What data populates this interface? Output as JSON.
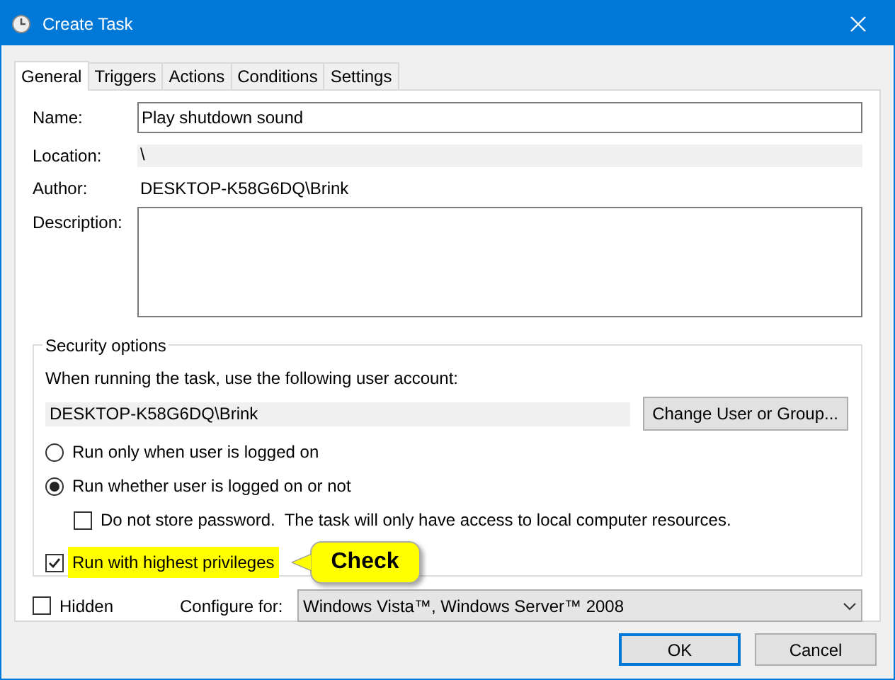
{
  "window": {
    "title": "Create Task"
  },
  "tabs": [
    {
      "label": "General",
      "selected": true
    },
    {
      "label": "Triggers",
      "selected": false
    },
    {
      "label": "Actions",
      "selected": false
    },
    {
      "label": "Conditions",
      "selected": false
    },
    {
      "label": "Settings",
      "selected": false
    }
  ],
  "general": {
    "name": {
      "label": "Name:",
      "value": "Play shutdown sound"
    },
    "location": {
      "label": "Location:",
      "value": "\\"
    },
    "author": {
      "label": "Author:",
      "value": "DESKTOP-K58G6DQ\\Brink"
    },
    "description": {
      "label": "Description:"
    },
    "security": {
      "title": "Security options",
      "prompt": "When running the task, use the following user account:",
      "account": "DESKTOP-K58G6DQ\\Brink",
      "change_button": "Change User or Group...",
      "options": [
        {
          "kind": "radio",
          "label": "Run only when user is logged on",
          "selected": false
        },
        {
          "kind": "radio",
          "label": "Run whether user is logged on or not",
          "selected": true,
          "children": [
            {
              "kind": "checkbox",
              "label": "Do not store password.  The task will only have access to local computer resources.",
              "checked": false
            }
          ]
        }
      ],
      "highest": {
        "label": "Run with highest privileges",
        "checked": true,
        "highlighted": true,
        "callout": "Check"
      }
    },
    "hidden": {
      "label": "Hidden",
      "checked": false
    },
    "configure": {
      "label": "Configure for:",
      "value": "Windows Vista™, Windows Server™ 2008"
    }
  },
  "buttons": [
    {
      "label": "OK",
      "default": true
    },
    {
      "label": "Cancel",
      "default": false
    }
  ]
}
